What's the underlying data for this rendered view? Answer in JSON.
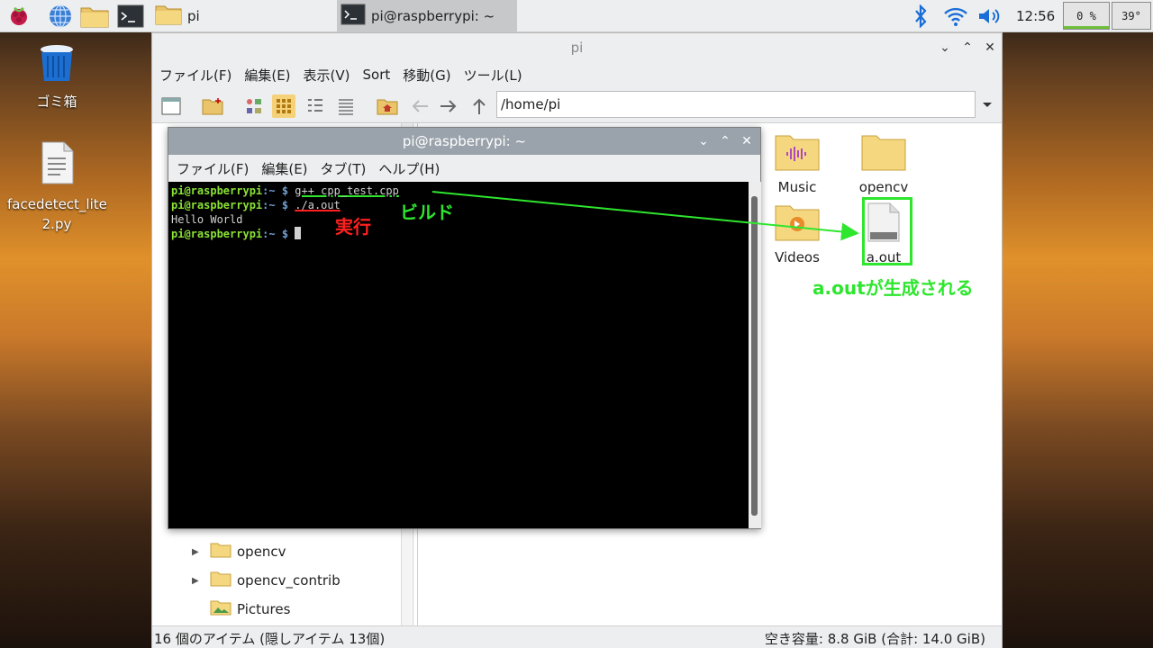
{
  "panel": {
    "launchers": [
      "raspberry-menu",
      "web-browser",
      "file-manager",
      "terminal"
    ],
    "tasks": [
      {
        "label": "pi",
        "icon": "folder-icon"
      },
      {
        "label": "pi@raspberrypi: ~",
        "icon": "terminal-icon"
      }
    ],
    "clock": "12:56",
    "cpu": "0 %",
    "temperature": "39°"
  },
  "desktop": {
    "icons": [
      {
        "label": "ゴミ箱",
        "icon": "trash-icon"
      },
      {
        "label": "facedetect_lite\n2.py",
        "icon": "python-file-icon"
      }
    ]
  },
  "file_manager": {
    "title": "pi",
    "menu": [
      "ファイル(F)",
      "編集(E)",
      "表示(V)",
      "Sort",
      "移動(G)",
      "ツール(L)"
    ],
    "path": "/home/pi",
    "tree": [
      {
        "label": "opencv",
        "expandable": true
      },
      {
        "label": "opencv_contrib",
        "expandable": true
      },
      {
        "label": "Pictures",
        "expandable": false
      }
    ],
    "files": [
      {
        "label": "Music",
        "icon": "music-folder-icon"
      },
      {
        "label": "opencv",
        "icon": "folder-icon"
      },
      {
        "label": "Videos",
        "icon": "video-folder-icon"
      },
      {
        "label": "a.out",
        "icon": "binary-file-icon"
      }
    ],
    "status_left": "16 個のアイテム (隠しアイテム 13個)",
    "status_right": "空き容量: 8.8 GiB (合計: 14.0 GiB)"
  },
  "terminal": {
    "title": "pi@raspberrypi: ~",
    "menu": [
      "ファイル(F)",
      "編集(E)",
      "タブ(T)",
      "ヘルプ(H)"
    ],
    "prompt_user": "pi@raspberrypi",
    "prompt_path": ":~ $ ",
    "commands": [
      "g++ cpp_test.cpp",
      "./a.out"
    ],
    "output": "Hello World"
  },
  "annotations": {
    "build": "ビルド",
    "run": "実行",
    "generated": "a.outが生成される",
    "color_green": "#2ee62e",
    "color_red": "#ff2020"
  }
}
